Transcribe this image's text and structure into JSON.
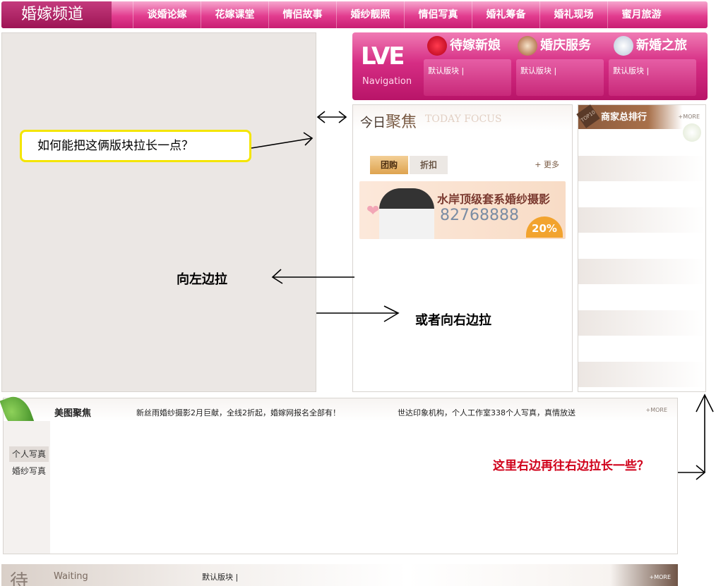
{
  "nav": {
    "brand": "婚嫁频道",
    "items": [
      "谈婚论嫁",
      "花嫁课堂",
      "情侣故事",
      "婚纱靓照",
      "情侣写真",
      "婚礼筹备",
      "婚礼现场",
      "蜜月旅游"
    ]
  },
  "love_banner": {
    "logo": "LVE",
    "subtitle": "Navigation",
    "tabs": [
      {
        "label": "待嫁新娘",
        "icon": "rose-icon"
      },
      {
        "label": "婚庆服务",
        "icon": "cake-icon"
      },
      {
        "label": "新婚之旅",
        "icon": "ring-icon"
      }
    ],
    "boxes": [
      "默认版块 |",
      "默认版块 |",
      "默认版块 |"
    ]
  },
  "focus": {
    "title_prefix": "今日",
    "title_main": "聚焦",
    "title_en": "TODAY FOCUS",
    "tabs": [
      "团购",
      "折扣"
    ],
    "more": "+ 更多",
    "ad": {
      "text": "水岸顶级套系婚纱摄影",
      "phone": "82768888",
      "badge": "20%"
    }
  },
  "rank": {
    "title": "商家总排行",
    "more": "+MORE",
    "tag": "TOP10"
  },
  "photo_section": {
    "title": "美图聚焦",
    "news": [
      "新丝雨婚纱摄影2月巨献，全线2折起，婚嫁网报名全部有！",
      "世达印象机构，个人工作室338个人写真，真情放送"
    ],
    "more": "+MORE",
    "side_items": [
      "个人写真",
      "婚纱写真"
    ]
  },
  "waiting": {
    "char": "待",
    "en": "Waiting",
    "default": "默认版块 |",
    "more": "+MORE"
  },
  "annotations": {
    "callout": "如何能把这俩版块拉长一点？",
    "left": "向左边拉",
    "right": "或者向右边拉",
    "bottom_note": "这里右边再往右边拉长一些？"
  },
  "colors": {
    "nav_pink": "#e23c8f",
    "brand_dark": "#9d1454",
    "annotation_red": "#d0021b",
    "callout_yellow": "#f4e500"
  }
}
